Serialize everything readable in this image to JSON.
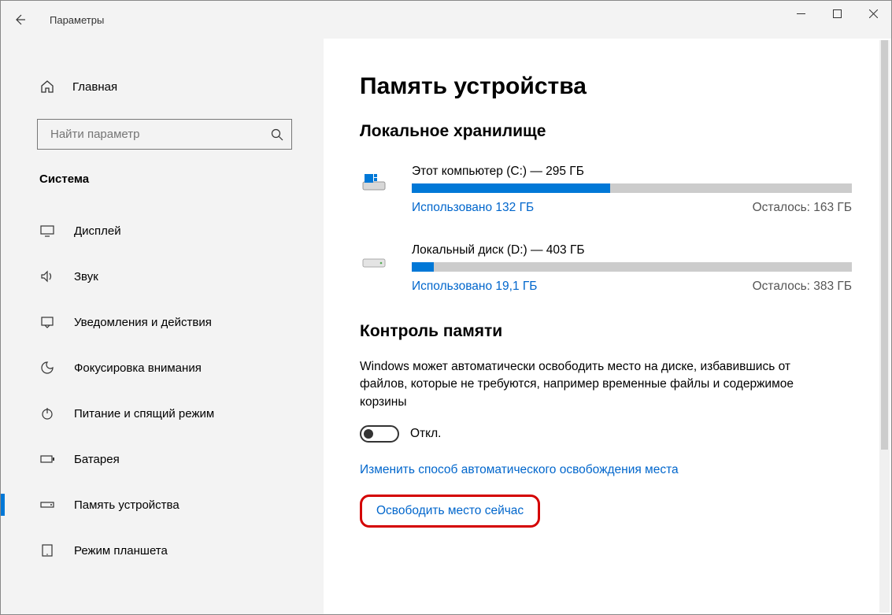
{
  "window": {
    "title": "Параметры"
  },
  "sidebar": {
    "home": "Главная",
    "search_placeholder": "Найти параметр",
    "category": "Система",
    "items": [
      {
        "label": "Дисплей"
      },
      {
        "label": "Звук"
      },
      {
        "label": "Уведомления и действия"
      },
      {
        "label": "Фокусировка внимания"
      },
      {
        "label": "Питание и спящий режим"
      },
      {
        "label": "Батарея"
      },
      {
        "label": "Память устройства"
      },
      {
        "label": "Режим планшета"
      }
    ]
  },
  "main": {
    "title": "Память устройства",
    "local_storage_title": "Локальное хранилище",
    "drives": [
      {
        "name": "Этот компьютер (C:) — 295 ГБ",
        "used": "Использовано 132 ГБ",
        "free": "Осталось: 163 ГБ",
        "fill_pct": 45
      },
      {
        "name": "Локальный диск (D:) — 403 ГБ",
        "used": "Использовано 19,1 ГБ",
        "free": "Осталось: 383 ГБ",
        "fill_pct": 5
      }
    ],
    "storage_sense": {
      "title": "Контроль памяти",
      "desc": "Windows может автоматически освободить место на диске, избавившись от файлов, которые не требуются, например временные файлы и содержимое корзины",
      "toggle_label": "Откл.",
      "link_change": "Изменить способ автоматического освобождения места",
      "link_free_now": "Освободить место сейчас"
    }
  }
}
